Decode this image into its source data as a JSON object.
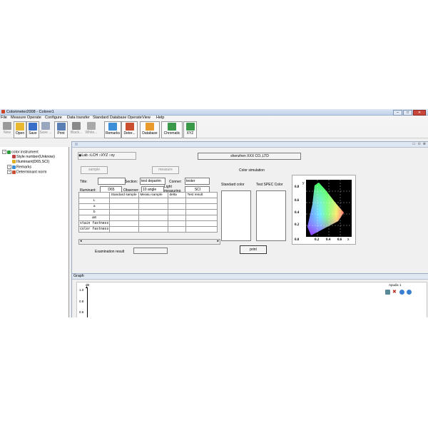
{
  "window": {
    "title": "Colorimeter2008 - Colorer1"
  },
  "menu": [
    "File",
    "Measure Operate",
    "Configure",
    "Data transfer",
    "Standard Database Operate",
    "View",
    "Help"
  ],
  "toolbar": [
    {
      "label": "New",
      "disabled": true
    },
    {
      "label": "Open",
      "disabled": false
    },
    {
      "label": "Save",
      "disabled": false
    },
    {
      "label": "Save ...",
      "disabled": true
    },
    {
      "label": "Print",
      "disabled": false
    },
    {
      "label": "Black...",
      "disabled": true
    },
    {
      "label": "White...",
      "disabled": true
    },
    {
      "label": "Remarks",
      "disabled": false
    },
    {
      "label": "Deter...",
      "disabled": false
    },
    {
      "label": "Database",
      "disabled": false
    },
    {
      "label": "Chromatic",
      "disabled": false
    },
    {
      "label": "XYZ",
      "disabled": false
    }
  ],
  "tree": {
    "root": "color instrument",
    "items": [
      "Style number(Unknow)",
      "Illuminant(D65,SCI)",
      "Remarks",
      "Determinant norm"
    ]
  },
  "form": {
    "color_spaces": [
      "Lab",
      "LCH",
      "XYZ",
      "xy"
    ],
    "company": "shenzhen XXX CO.,LTD",
    "sample_button": "sample",
    "measure_button": "measure",
    "title_label": "Title:",
    "title_value": "",
    "section_label": "Section:",
    "section_value": "test departm",
    "conner_label": "Conner:",
    "conner_value": "tester",
    "illuminant_label": "Illuminant:",
    "illuminant_value": "D65",
    "observer_label": "Observer:",
    "observer_value": "10 angle",
    "light_label": "Light measuring",
    "light_value": "SCI",
    "color_simulation": "Color simulation",
    "standard_color": "Standard color",
    "test_color": "Test SPEC Color",
    "print_button": "print",
    "exam_label": "Examination result",
    "exam_value": ""
  },
  "table": {
    "headers": [
      "",
      "Standard sample",
      "Measu sample",
      "delta",
      "Test result"
    ],
    "rows": [
      "L",
      "a",
      "b",
      "ΔE",
      "stain fastness",
      "color fastness"
    ]
  },
  "chromaticity": {
    "y_label": "y",
    "x_label": "x",
    "y_ticks": [
      "0.8",
      "0.6",
      "0.4",
      "0.2",
      "0.0"
    ],
    "x_ticks": [
      "0.2",
      "0.4",
      "0.6"
    ]
  },
  "graph": {
    "title": "Graph",
    "y_axis_title": "dE",
    "y_ticks": [
      "1.0",
      "0.8",
      "0.6"
    ],
    "legend": "Apudix 1"
  }
}
